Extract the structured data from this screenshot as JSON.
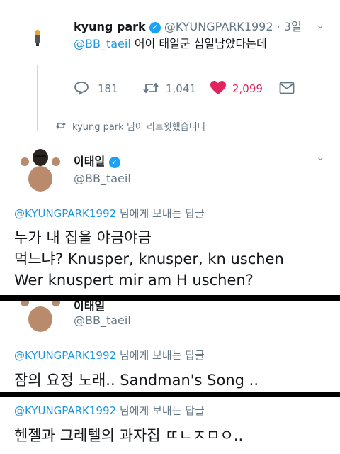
{
  "tweet1": {
    "name": "kyung park",
    "handle": "@KYUNGPARK1992",
    "dot": "·",
    "time": "3일",
    "reply_mention": "@BB_taeil",
    "text": "어이 태일군 십일남았다는데",
    "replies": "181",
    "retweets": "1,041",
    "likes": "2,099"
  },
  "retweet_notice": {
    "text": "kyung park 님이 리트윗했습니다"
  },
  "tweet2": {
    "name": "이태일",
    "handle": "@BB_taeil",
    "reply_to_handle": "@KYUNGPARK1992",
    "reply_to_suffix": "님에게 보내는 답글",
    "line1": "누가 내 집을 야금야금",
    "line2": "먹느냐?  Knusper, knusper, kn uschen",
    "line3": "Wer knuspert mir am H uschen?"
  },
  "tweet3": {
    "name": "이태일",
    "handle": "@BB_taeil",
    "reply_to_handle": "@KYUNGPARK1992",
    "reply_to_suffix": "님에게 보내는 답글",
    "text": "잠의 요정 노래.. Sandman's Song .."
  },
  "tweet4": {
    "reply_to_handle": "@KYUNGPARK1992",
    "reply_to_suffix": "님에게 보내는 답글",
    "text": "헨젤과 그레텔의 과자집 ㄸㄴㅈㅁㅇ.."
  },
  "colors": {
    "link": "#1b95e0",
    "like": "#e0245e",
    "muted": "#657786",
    "verified": "#1da1f2"
  }
}
